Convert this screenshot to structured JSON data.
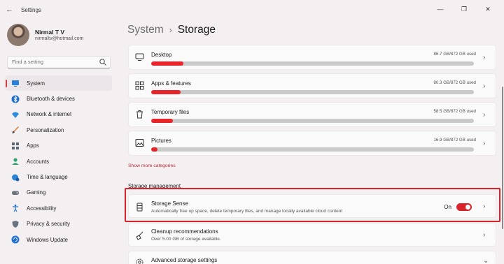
{
  "window": {
    "title": "Settings"
  },
  "user": {
    "name": "Nirmal T V",
    "email": "nirmaltv@hotmail.com"
  },
  "search": {
    "placeholder": "Find a setting"
  },
  "nav": {
    "items": [
      {
        "label": "System",
        "icon": "monitor-icon",
        "active": true
      },
      {
        "label": "Bluetooth & devices",
        "icon": "bluetooth-icon"
      },
      {
        "label": "Network & internet",
        "icon": "wifi-icon"
      },
      {
        "label": "Personalization",
        "icon": "brush-icon"
      },
      {
        "label": "Apps",
        "icon": "apps-icon"
      },
      {
        "label": "Accounts",
        "icon": "person-icon"
      },
      {
        "label": "Time & language",
        "icon": "globe-clock-icon"
      },
      {
        "label": "Gaming",
        "icon": "gamepad-icon"
      },
      {
        "label": "Accessibility",
        "icon": "accessibility-icon"
      },
      {
        "label": "Privacy & security",
        "icon": "shield-icon"
      },
      {
        "label": "Windows Update",
        "icon": "update-icon"
      }
    ]
  },
  "breadcrumb": {
    "parent": "System",
    "separator": "›",
    "current": "Storage"
  },
  "categories": [
    {
      "label": "Desktop",
      "used": "86.7 GB/872 GB used",
      "fraction": 0.099,
      "icon": "desktop-icon"
    },
    {
      "label": "Apps & features",
      "used": "80.3 GB/872 GB used",
      "fraction": 0.092,
      "icon": "apps-features-icon"
    },
    {
      "label": "Temporary files",
      "used": "58.5 GB/872 GB used",
      "fraction": 0.067,
      "icon": "trash-icon"
    },
    {
      "label": "Pictures",
      "used": "16.9 GB/872 GB used",
      "fraction": 0.019,
      "icon": "picture-icon"
    }
  ],
  "show_more": "Show more categories",
  "storage_management": {
    "title": "Storage management",
    "storage_sense": {
      "label": "Storage Sense",
      "description": "Automatically free up space, delete temporary files, and manage locally available cloud content",
      "state": "On",
      "on": true
    },
    "cleanup": {
      "label": "Cleanup recommendations",
      "description": "Over 5.00 GB of storage available."
    },
    "advanced": {
      "label": "Advanced storage settings"
    }
  },
  "colors": {
    "accent": "#e8242b",
    "highlight": "#d8232a"
  }
}
